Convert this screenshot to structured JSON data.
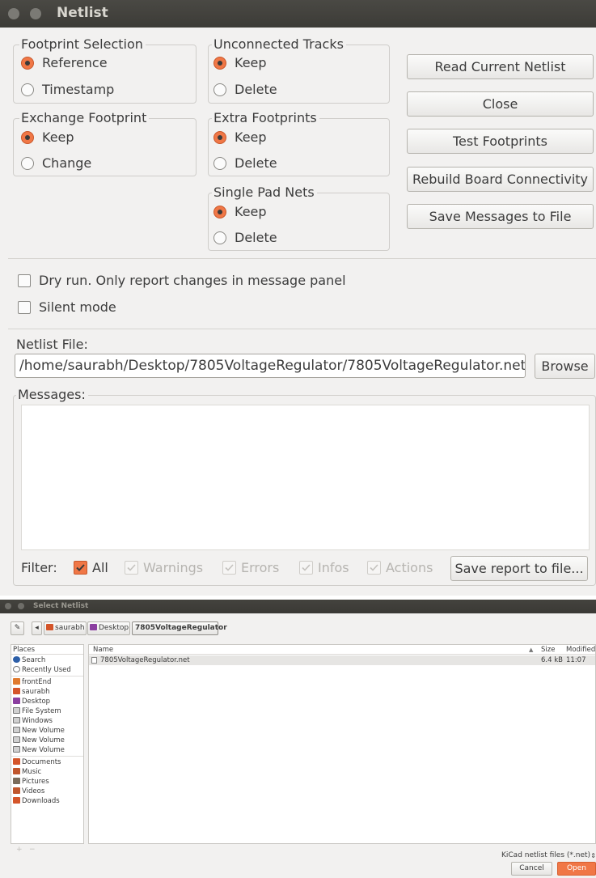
{
  "netlist": {
    "title": "Netlist",
    "footprint_selection": {
      "label": "Footprint Selection",
      "options": [
        "Reference",
        "Timestamp"
      ]
    },
    "exchange_footprint": {
      "label": "Exchange Footprint",
      "options": [
        "Keep",
        "Change"
      ]
    },
    "unconnected_tracks": {
      "label": "Unconnected Tracks",
      "options": [
        "Keep",
        "Delete"
      ]
    },
    "extra_footprints": {
      "label": "Extra Footprints",
      "options": [
        "Keep",
        "Delete"
      ]
    },
    "single_pad_nets": {
      "label": "Single Pad Nets",
      "options": [
        "Keep",
        "Delete"
      ]
    },
    "buttons": {
      "read": "Read Current Netlist",
      "close": "Close",
      "test": "Test Footprints",
      "rebuild": "Rebuild Board Connectivity",
      "save_messages": "Save Messages to File"
    },
    "dry_run": "Dry run. Only report changes in message panel",
    "silent_mode": "Silent mode",
    "netlist_file_label": "Netlist File:",
    "netlist_file_value": "/home/saurabh/Desktop/7805VoltageRegulator/7805VoltageRegulator.net",
    "browse": "Browse",
    "messages_label": "Messages:",
    "filter": {
      "label": "Filter:",
      "all": "All",
      "warnings": "Warnings",
      "errors": "Errors",
      "infos": "Infos",
      "actions": "Actions",
      "save_report": "Save report to file..."
    }
  },
  "select_netlist": {
    "title": "Select Netlist",
    "path": [
      "saurabh",
      "Desktop",
      "7805VoltageRegulator"
    ],
    "places_header": "Places",
    "places": [
      {
        "label": "Search",
        "icon": "search-icon",
        "color": "#2d5fa8"
      },
      {
        "label": "Recently Used",
        "icon": "clock-icon",
        "color": "#777777"
      },
      {
        "label": "frontEnd",
        "icon": "folder-icon",
        "color": "#e07a2e"
      },
      {
        "label": "saurabh",
        "icon": "home-folder-icon",
        "color": "#d4552a"
      },
      {
        "label": "Desktop",
        "icon": "desktop-icon",
        "color": "#8b3fa0"
      },
      {
        "label": "File System",
        "icon": "drive-icon",
        "color": "#8a8a8a"
      },
      {
        "label": "Windows",
        "icon": "drive-icon",
        "color": "#8a8a8a"
      },
      {
        "label": "New Volume",
        "icon": "drive-icon",
        "color": "#8a8a8a"
      },
      {
        "label": "New Volume",
        "icon": "drive-icon",
        "color": "#8a8a8a"
      },
      {
        "label": "New Volume",
        "icon": "drive-icon",
        "color": "#8a8a8a"
      },
      {
        "label": "Documents",
        "icon": "documents-icon",
        "color": "#d4552a"
      },
      {
        "label": "Music",
        "icon": "music-icon",
        "color": "#c0562c"
      },
      {
        "label": "Pictures",
        "icon": "pictures-icon",
        "color": "#7a6b5a"
      },
      {
        "label": "Videos",
        "icon": "videos-icon",
        "color": "#c0562c"
      },
      {
        "label": "Downloads",
        "icon": "downloads-icon",
        "color": "#d4552a"
      }
    ],
    "columns": {
      "name": "Name",
      "size": "Size",
      "modified": "Modified"
    },
    "files": [
      {
        "name": "7805VoltageRegulator.net",
        "size": "6.4 kB",
        "modified": "11:07"
      }
    ],
    "filter_select": "KiCad netlist files (*.net)",
    "cancel": "Cancel",
    "open": "Open"
  },
  "colors": {
    "accent": "#f07746",
    "titlebar": "#3c3b37",
    "window_bg": "#f2f1f0"
  }
}
